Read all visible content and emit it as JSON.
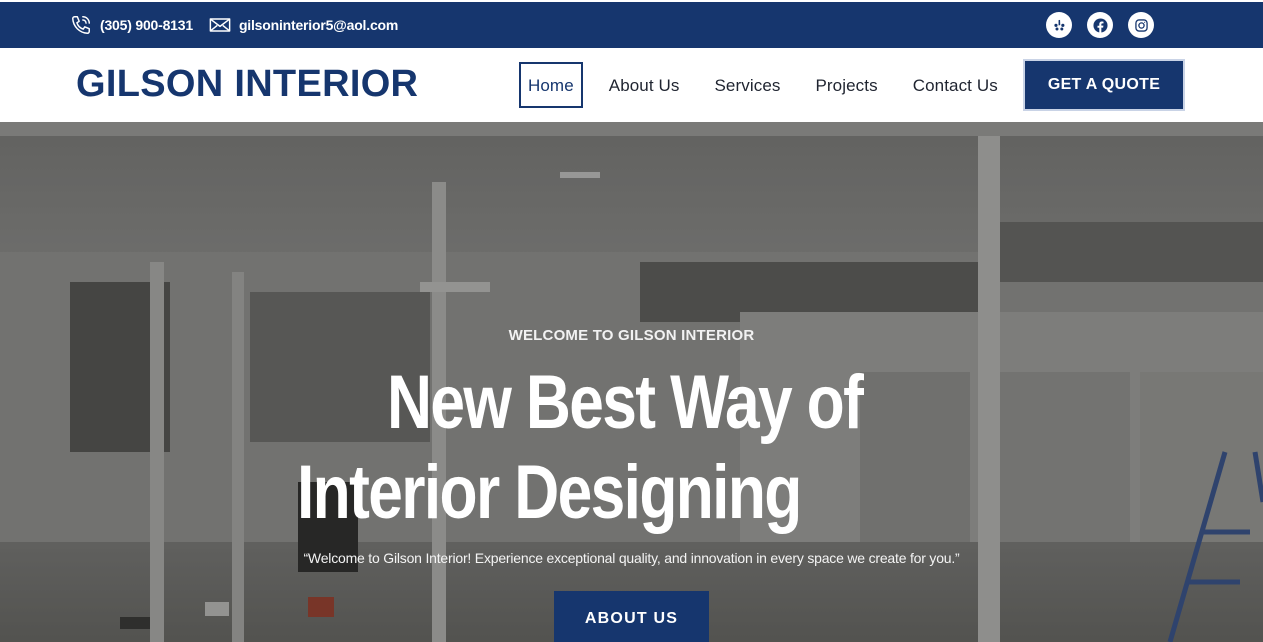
{
  "topbar": {
    "phone": "(305) 900-8131",
    "email": "gilsoninterior5@aol.com",
    "phone_icon": "phone-icon",
    "email_icon": "mail-icon",
    "socials": [
      "yelp-icon",
      "facebook-icon",
      "instagram-icon"
    ],
    "background": "#16366e"
  },
  "header": {
    "logo": "GILSON INTERIOR",
    "nav": [
      "Home",
      "About Us",
      "Services",
      "Projects",
      "Contact Us"
    ],
    "active": "Home",
    "cta": "GET A QUOTE",
    "brand_color": "#16366e"
  },
  "hero": {
    "eyebrow": "WELCOME TO GILSON INTERIOR",
    "title_line1": "New Best Way of",
    "title_line2": "Interior Designing",
    "quote": "“Welcome to Gilson Interior! Experience exceptional quality, and innovation in every space we create for you.”",
    "button": "ABOUT US"
  }
}
